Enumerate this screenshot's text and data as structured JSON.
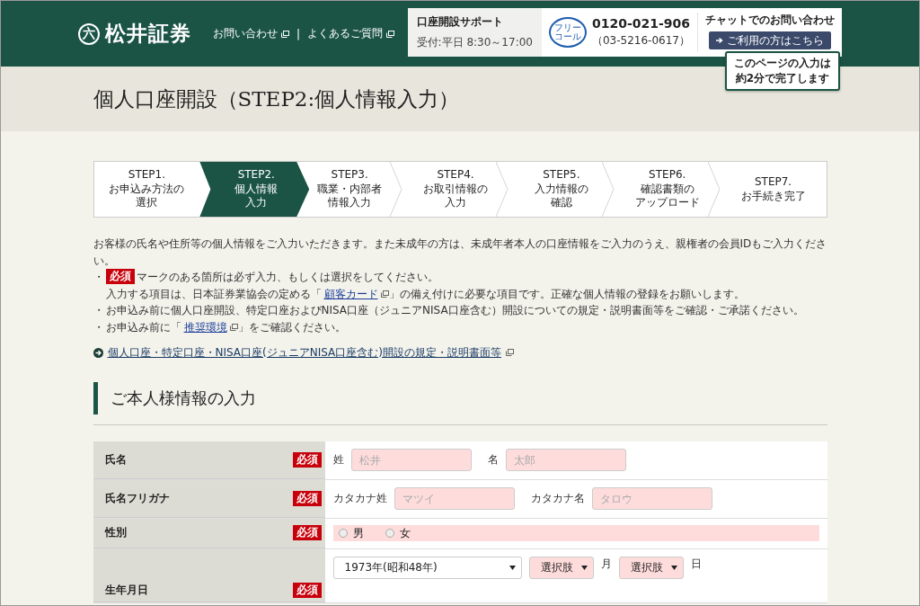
{
  "header": {
    "logo_mark": "六",
    "logo_text": "松井証券",
    "links": [
      {
        "label": "お問い合わせ"
      },
      {
        "label": "よくあるご質問"
      }
    ],
    "separator": "|",
    "support": {
      "title": "口座開設サポート",
      "hours": "受付:平日 8:30～17:00",
      "free_dial_mark": [
        "フリー",
        "コール"
      ],
      "phone": "0120-021-906",
      "phone_alt": "（03-5216-0617）",
      "chat_label": "チャットでのお問い合わせ",
      "chat_button": "ご利用の方はこちら"
    },
    "tooltip": [
      "このページの入力は",
      "約2分で完了します"
    ]
  },
  "page_title": "個人口座開設（STEP2:個人情報入力）",
  "steps": [
    {
      "lines": [
        "STEP1.",
        "お申込み方法の",
        "選択"
      ],
      "selected": false
    },
    {
      "lines": [
        "STEP2.",
        "個人情報",
        "入力"
      ],
      "selected": true
    },
    {
      "lines": [
        "STEP3.",
        "職業・内部者",
        "情報入力"
      ],
      "selected": false
    },
    {
      "lines": [
        "STEP4.",
        "お取引情報の",
        "入力"
      ],
      "selected": false
    },
    {
      "lines": [
        "STEP5.",
        "入力情報の",
        "確認"
      ],
      "selected": false
    },
    {
      "lines": [
        "STEP6.",
        "確認書類の",
        "アップロード"
      ],
      "selected": false
    },
    {
      "lines": [
        "STEP7.",
        "お手続き完了"
      ],
      "selected": false
    }
  ],
  "intro": "お客様の氏名や住所等の個人情報をご入力いただきます。また未成年の方は、未成年者本人の口座情報をご入力のうえ、親権者の会員IDもご入力ください。",
  "notes": [
    {
      "kind": "badge",
      "bullet": "・",
      "badge": "必須",
      "text": "マークのある箇所は必ず入力、もしくは選択をしてください。"
    },
    {
      "kind": "link",
      "before": "入力する項目は、日本証券業協会の定める「",
      "link": "顧客カード",
      "after": "」の備え付けに必要な項目です。正確な個人情報の登録をお願いします。"
    },
    {
      "kind": "plain",
      "bullet": "・",
      "text": "お申込み前に個人口座開設、特定口座およびNISA口座（ジュニアNISA口座含む）開設についての規定・説明書面等をご確認・ご承諾ください。"
    },
    {
      "kind": "link",
      "bullet": "・",
      "before": "お申込み前に「",
      "link": "推奨環境",
      "after": "」をご確認ください。"
    }
  ],
  "doc_link": "個人口座・特定口座・NISA口座(ジュニアNISA口座含む)開設の規定・説明書面等",
  "section_title": "ご本人様情報の入力",
  "form_rows": [
    {
      "label": "氏名",
      "badge": "必須",
      "kind": "text",
      "fields": [
        {
          "prefix": "姓",
          "placeholder": "松井",
          "highlighted": true
        },
        {
          "prefix": "名",
          "placeholder": "太郎",
          "highlighted": true
        }
      ]
    },
    {
      "label": "氏名フリガナ",
      "badge": "必須",
      "kind": "text",
      "fields": [
        {
          "prefix": "カタカナ姓",
          "placeholder": "マツイ",
          "highlighted": true
        },
        {
          "prefix": "カタカナ名",
          "placeholder": "タロウ",
          "highlighted": true
        }
      ]
    },
    {
      "label": "性別",
      "badge": "必須",
      "kind": "radio",
      "highlighted": true,
      "options": [
        {
          "label": "男",
          "selected": false
        },
        {
          "label": "女",
          "selected": false
        }
      ]
    },
    {
      "label": "生年月日",
      "badge": "必須",
      "kind": "date",
      "selects": [
        {
          "value": "1973年(昭和48年)",
          "highlighted": false
        },
        {
          "value": "選択肢",
          "suffix": "月",
          "highlighted": true
        },
        {
          "value": "選択肢",
          "suffix": "日",
          "highlighted": true
        }
      ]
    }
  ]
}
